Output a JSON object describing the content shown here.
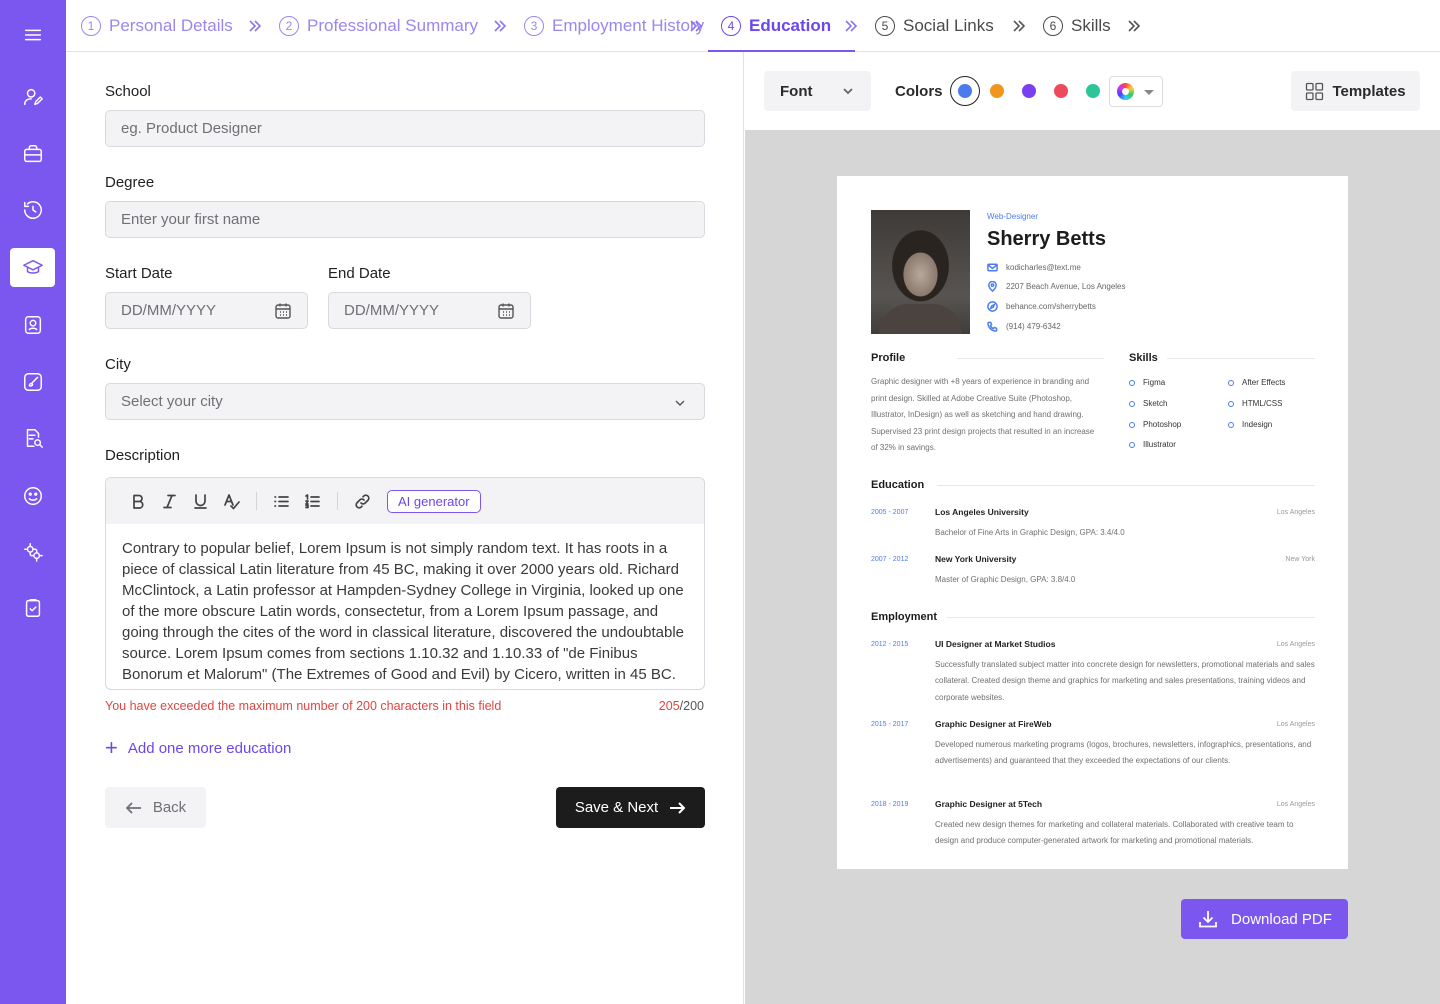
{
  "steps": [
    {
      "num": "1",
      "label": "Personal Details",
      "state": "done"
    },
    {
      "num": "2",
      "label": "Professional Summary",
      "state": "done"
    },
    {
      "num": "3",
      "label": "Employment History",
      "state": "done"
    },
    {
      "num": "4",
      "label": "Education",
      "state": "active"
    },
    {
      "num": "5",
      "label": "Social Links",
      "state": "todo"
    },
    {
      "num": "6",
      "label": "Skills",
      "state": "todo"
    }
  ],
  "sidebar": {
    "icons": [
      "menu-icon",
      "user-edit-icon",
      "briefcase-icon",
      "history-icon",
      "graduation-cap-icon",
      "badge-icon",
      "brush-icon",
      "document-search-icon",
      "emoji-icon",
      "gears-icon",
      "clipboard-check-icon"
    ],
    "active": "graduation-cap-icon"
  },
  "form": {
    "school_label": "School",
    "school_placeholder": "eg. Product Designer",
    "degree_label": "Degree",
    "degree_placeholder": "Enter your first name",
    "start_label": "Start Date",
    "start_placeholder": "DD/MM/YYYY",
    "end_label": "End Date",
    "end_placeholder": "DD/MM/YYYY",
    "city_label": "City",
    "city_placeholder": "Select your city",
    "description_label": "Description",
    "ai_generator": "AI generator",
    "description_text": "Contrary to popular belief, Lorem Ipsum is not simply random text. It has roots in a piece of classical Latin literature from 45 BC, making it over 2000 years old. Richard McClintock, a Latin professor at Hampden-Sydney College in Virginia, looked up one of the more obscure Latin words, consectetur, from a Lorem Ipsum passage, and going through the cites of the word in classical literature, discovered the undoubtable source. Lorem Ipsum comes from sections 1.10.32 and 1.10.33 of \"de Finibus Bonorum et Malorum\" (The Extremes of Good and Evil) by Cicero, written in 45 BC.",
    "error_text": "You have exceeded the maximum number of  200 characters in this field",
    "count_current": "205",
    "count_max": "/200",
    "add_more": "Add one more education",
    "back": "Back",
    "save_next": "Save & Next"
  },
  "preview_toolbar": {
    "font": "Font",
    "colors_label": "Colors",
    "colors": [
      "#4a7cf0",
      "#f0961e",
      "#7b3ff2",
      "#ef4a5c",
      "#2ec49a"
    ],
    "selected_color": "#4a7cf0",
    "templates": "Templates",
    "download": "Download PDF"
  },
  "resume": {
    "role": "Web-Designer",
    "name": "Sherry Betts",
    "email": "kodicharles@text.me",
    "address": "2207 Beach Avenue, Los Angeles",
    "website": "behance.com/sherrybetts",
    "phone": "(914) 479-6342",
    "profile_heading": "Profile",
    "profile_text": "Graphic designer with +8 years of experience in branding and print design. Skilled at Adobe Creative Suite (Photoshop, Illustrator, InDesign) as well as sketching and hand drawing. Supervised 23 print design projects that resulted in an increase of 32% in savings.",
    "skills_heading": "Skills",
    "skills": [
      "Figma",
      "Sketch",
      "Photoshop",
      "Illustrator",
      "After Effects",
      "HTML/CSS",
      "Indesign"
    ],
    "education_heading": "Education",
    "education": [
      {
        "dates": "2005 - 2007",
        "school": "Los Angeles University",
        "location": "Los Angeles",
        "detail": "Bachelor of Fine Arts in Graphic Design, GPA: 3.4/4.0"
      },
      {
        "dates": "2007 - 2012",
        "school": "New York University",
        "location": "New York",
        "detail": "Master of Graphic Design, GPA: 3.8/4.0"
      }
    ],
    "employment_heading": "Employment",
    "employment": [
      {
        "dates": "2012 - 2015",
        "title": "UI Designer at Market Studios",
        "location": "Los Angeles",
        "detail": "Successfully translated subject matter into concrete design for newsletters, promotional materials and sales collateral. Created design theme and graphics for marketing and sales presentations, training videos and corporate websites."
      },
      {
        "dates": "2015 - 2017",
        "title": "Graphic Designer at FireWeb",
        "location": "Los Angeles",
        "detail": "Developed numerous marketing programs (logos, brochures, newsletters, infographics, presentations, and advertisements) and guaranteed that they exceeded the expectations of our clients."
      },
      {
        "dates": "2018 - 2019",
        "title": "Graphic Designer at 5Tech",
        "location": "Los Angeles",
        "detail": "Created new design themes for marketing and collateral materials. Collaborated with creative team to design and produce computer-generated artwork for marketing and promotional materials."
      }
    ]
  }
}
